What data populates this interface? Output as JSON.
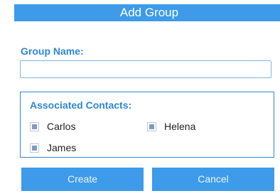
{
  "dialog": {
    "title": "Add Group"
  },
  "group_name": {
    "label": "Group Name:",
    "value": "",
    "placeholder": ""
  },
  "contacts": {
    "title": "Associated Contacts:",
    "items": [
      {
        "name": "Carlos",
        "checked": false
      },
      {
        "name": "Helena",
        "checked": false
      },
      {
        "name": "James",
        "checked": false
      }
    ]
  },
  "buttons": {
    "create_label": "Create",
    "cancel_label": "Cancel"
  },
  "colors": {
    "accent": "#3d9be9",
    "label": "#2f86d6"
  }
}
